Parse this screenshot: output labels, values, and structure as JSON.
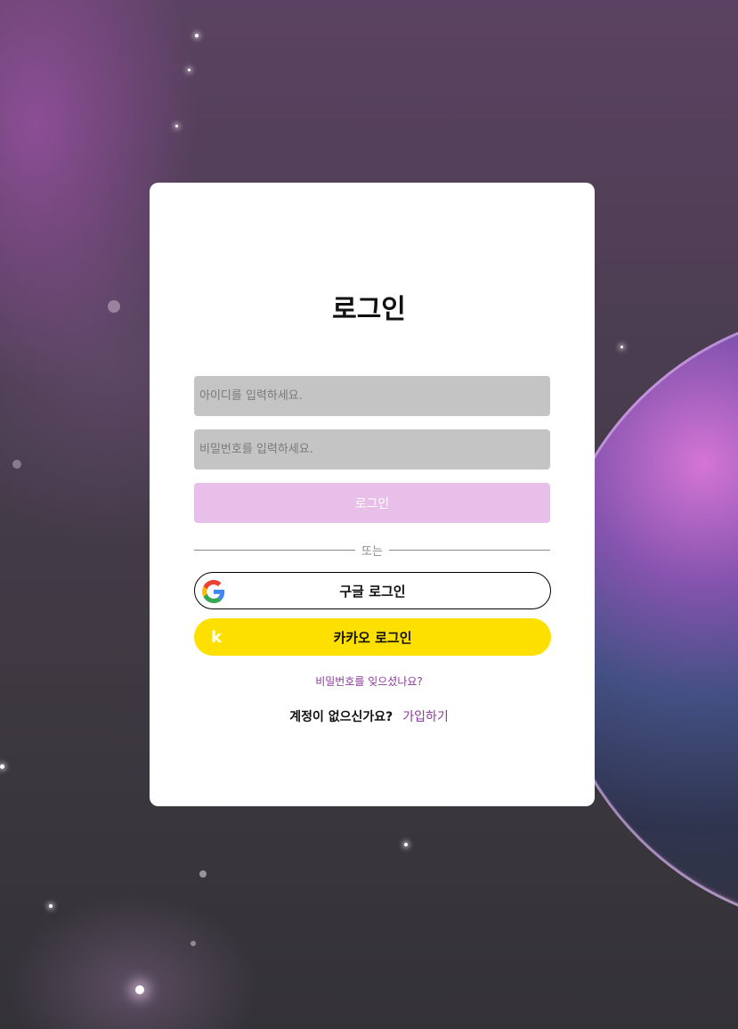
{
  "login": {
    "title": "로그인",
    "id_placeholder": "아이디를 입력하세요.",
    "password_placeholder": "비밀번호를 입력하세요.",
    "submit_label": "로그인",
    "divider_text": "또는",
    "google_label": "구글 로그인",
    "kakao_label": "카카오 로그인",
    "kakao_icon_text": "k",
    "forgot_password": "비밀번호를 잊으셨나요?",
    "no_account_text": "계정이 없으신가요?",
    "signup_link": "가입하기"
  },
  "colors": {
    "input_bg": "#c4c4c4",
    "submit_bg": "#e8bfe8",
    "kakao_bg": "#fee000",
    "link": "#8a3a9a"
  },
  "icons": {
    "google": "google-logo-icon",
    "kakao": "kakao-logo-icon"
  }
}
